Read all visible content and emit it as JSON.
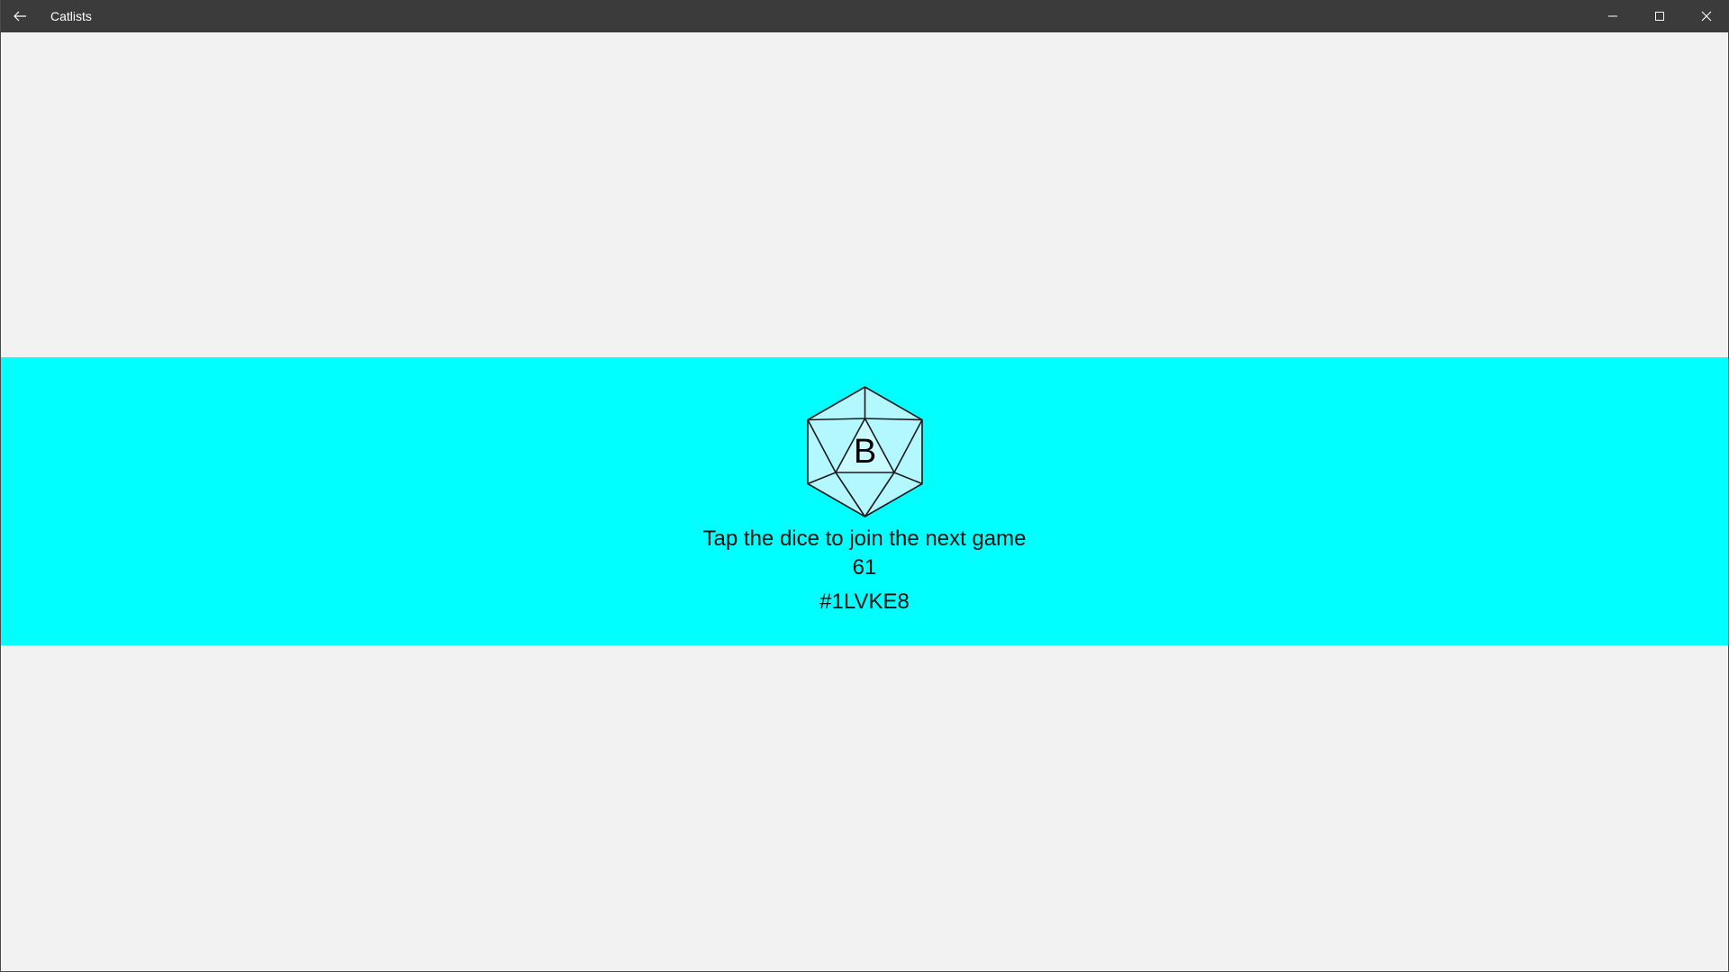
{
  "window": {
    "title": "Catlists",
    "icons": {
      "back": "back-arrow-icon",
      "minimize": "minimize-icon",
      "maximize": "maximize-icon",
      "close": "close-icon"
    }
  },
  "colors": {
    "titlebar": "#3b3b3b",
    "background": "#f2f2f2",
    "band": "#00ffff",
    "dice_fill": "#b3f8ff",
    "dice_stroke": "#1a1a1a"
  },
  "game": {
    "dice_letter": "B",
    "dice_icon": "d20-dice-icon",
    "prompt": "Tap the dice to join the next game",
    "count": "61",
    "code": "#1LVKE8"
  }
}
